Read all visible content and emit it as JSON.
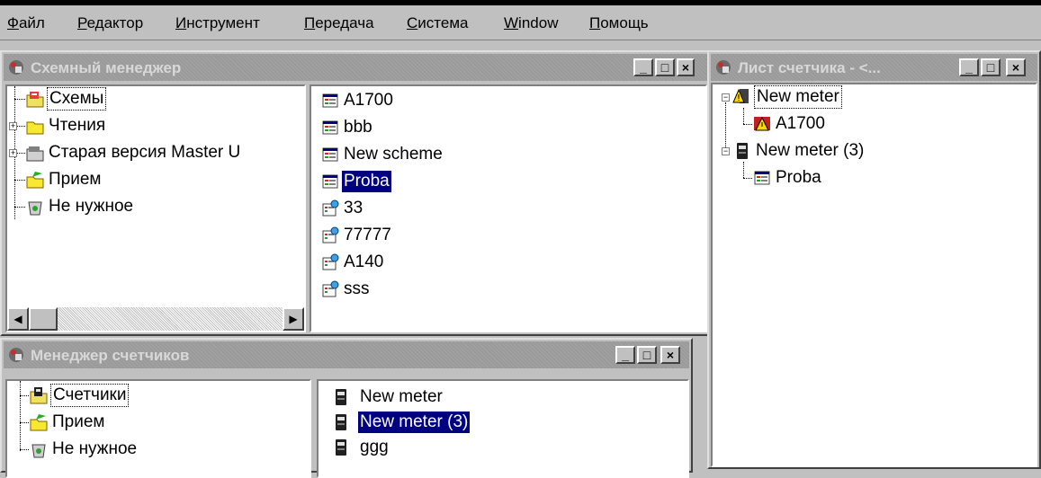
{
  "menu": {
    "items": [
      {
        "pre": "",
        "u": "Ф",
        "post": "айл"
      },
      {
        "pre": "",
        "u": "Р",
        "post": "едактор"
      },
      {
        "pre": "",
        "u": "И",
        "post": "нструмент"
      },
      {
        "pre": "",
        "u": "П",
        "post": "ередача"
      },
      {
        "pre": "",
        "u": "С",
        "post": "истема"
      },
      {
        "pre": "",
        "u": "W",
        "post": "indow"
      },
      {
        "pre": "",
        "u": "П",
        "post": "омощь"
      }
    ]
  },
  "scheme_manager": {
    "title": "Схемный менеджер",
    "tree": [
      "Схемы",
      "Чтения",
      "Старая версия Master U",
      "Прием",
      "Не нужное"
    ],
    "list": [
      "A1700",
      "bbb",
      "New scheme",
      "Proba",
      "33",
      "77777",
      "A140",
      "sss"
    ],
    "selected_item": "Proba"
  },
  "meter_sheet": {
    "title": "Лист счетчика - <...",
    "tree": [
      "New meter",
      "A1700",
      "New meter (3)",
      "Proba"
    ]
  },
  "meter_manager": {
    "title": "Менеджер счетчиков",
    "tree": [
      "Счетчики",
      "Прием",
      "Не нужное"
    ],
    "list": [
      "New meter",
      "New meter (3)",
      "ggg"
    ],
    "selected_item": "New meter (3)"
  },
  "window_buttons": {
    "minimize": "_",
    "maximize": "□",
    "close": "×"
  },
  "icons": {
    "window": "app-window-icon",
    "scheme": "scheme-icon",
    "reading": "reading-icon",
    "meter": "meter-icon",
    "folder": "folder-icon",
    "trash": "recycle-bin-icon",
    "warning": "warning-icon"
  }
}
